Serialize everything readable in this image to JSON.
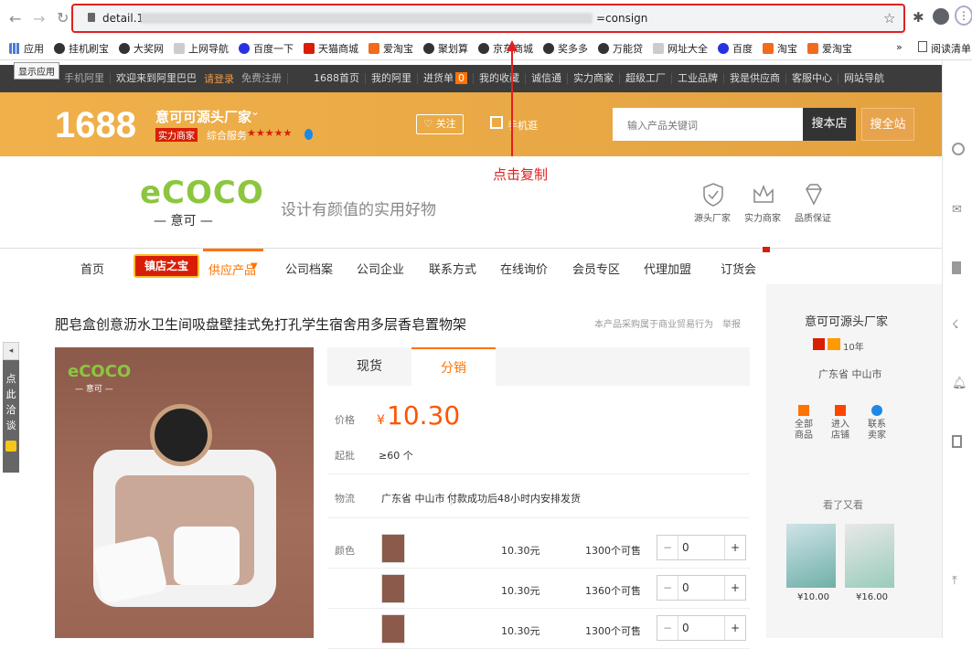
{
  "browser": {
    "url_prefix": "detail.1",
    "url_suffix": "=consign",
    "show_apps_tooltip": "显示应用"
  },
  "bookmarks": [
    {
      "label": "应用",
      "color": "#4a7bd8"
    },
    {
      "label": "挂机刷宝",
      "color": "#333"
    },
    {
      "label": "大奖网",
      "color": "#333"
    },
    {
      "label": "上网导航",
      "color": "#aaa"
    },
    {
      "label": "百度一下",
      "color": "#2932e1"
    },
    {
      "label": "天猫商城",
      "color": "#d81e06"
    },
    {
      "label": "爱淘宝",
      "color": "#f26b1d"
    },
    {
      "label": "聚划算",
      "color": "#333"
    },
    {
      "label": "京东商城",
      "color": "#333"
    },
    {
      "label": "奖多多",
      "color": "#333"
    },
    {
      "label": "万能贷",
      "color": "#333"
    },
    {
      "label": "网址大全",
      "color": "#aaa"
    },
    {
      "label": "百度",
      "color": "#2932e1"
    },
    {
      "label": "淘宝",
      "color": "#f26b1d"
    },
    {
      "label": "爱淘宝",
      "color": "#f26b1d"
    }
  ],
  "bookmarks_more": "»",
  "reading_list": "阅读清单",
  "topnav": {
    "mobile": "手机阿里",
    "welcome": "欢迎来到阿里巴巴",
    "login": "请登录",
    "register": "免费注册",
    "items": [
      "1688首页",
      "我的阿里",
      "进货单",
      "我的收藏",
      "诚信通",
      "实力商家",
      "超级工厂",
      "工业品牌",
      "我是供应商",
      "客服中心",
      "网站导航"
    ],
    "cart_count": "0"
  },
  "banner": {
    "logo": "1688",
    "shop_name": "意可可源头厂家",
    "badge": "实力商家",
    "service_label": "综合服务",
    "follow": "关注",
    "mobile_shop": "手机逛",
    "search_placeholder": "输入产品关键词",
    "search_shop": "搜本店",
    "search_all": "搜全站"
  },
  "annotation": {
    "text": "点击复制",
    "color": "#e02020"
  },
  "shophead": {
    "brand": "eCOCO",
    "brand_sub": "— 意可 —",
    "slogan": "设计有颜值的实用好物",
    "icons": [
      {
        "label": "源头厂家",
        "icon": "shield-icon"
      },
      {
        "label": "实力商家",
        "icon": "crown-icon"
      },
      {
        "label": "品质保证",
        "icon": "diamond-icon"
      }
    ]
  },
  "mainnav": {
    "items": [
      "首页",
      "供应产品",
      "公司档案",
      "公司企业",
      "联系方式",
      "在线询价",
      "会员专区",
      "代理加盟",
      "订货会"
    ],
    "promo": "镇店之宝",
    "arrow": "▼"
  },
  "product": {
    "title": "肥皂盒创意沥水卫生间吸盘壁挂式免打孔学生宿舍用多层香皂置物架",
    "notice": "本产品采购属于商业贸易行为",
    "report": "举报",
    "image_brand": "eCOCO",
    "image_brand_sub": "— 意可 —",
    "tabs": [
      "现货",
      "分销"
    ],
    "active_tab": 1,
    "price_label": "价格",
    "currency": "¥",
    "price": "10.30",
    "moq_label": "起批",
    "moq": "≥60 个",
    "shipping_label": "物流",
    "shipping_from": "广东省 中山市",
    "shipping_note": "付款成功后48小时内安排发货",
    "color_label": "颜色",
    "skus": [
      {
        "price": "10.30元",
        "stock": "1300个可售",
        "qty": "0"
      },
      {
        "price": "10.30元",
        "stock": "1360个可售",
        "qty": "0"
      },
      {
        "price": "10.30元",
        "stock": "1300个可售",
        "qty": "0"
      }
    ]
  },
  "leftfloat": {
    "text": [
      "点",
      "此",
      "洽",
      "谈"
    ]
  },
  "sidepanel": {
    "shop_name": "意可可源头厂家",
    "years": "10年",
    "location": "广东省 中山市",
    "actions": [
      "全部商品",
      "进入店铺",
      "联系卖家"
    ],
    "also_viewed": "看了又看",
    "related": [
      {
        "price": "¥10.00"
      },
      {
        "price": "¥16.00"
      }
    ]
  }
}
